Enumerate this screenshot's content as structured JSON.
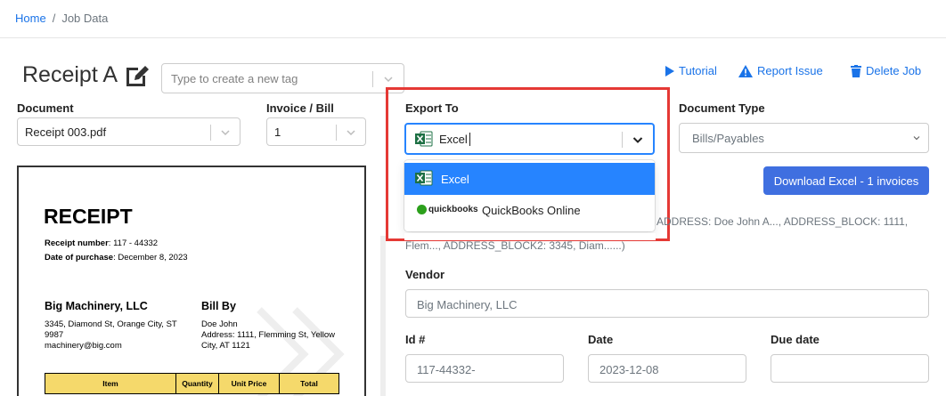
{
  "breadcrumb": {
    "home": "Home",
    "separator": "/",
    "current": "Job Data"
  },
  "header": {
    "title": "Receipt A",
    "tag_placeholder": "Type to create a new tag",
    "actions": {
      "tutorial": "Tutorial",
      "report": "Report Issue",
      "delete": "Delete Job"
    }
  },
  "document": {
    "label": "Document",
    "value": "Receipt 003.pdf"
  },
  "invoice": {
    "label": "Invoice / Bill",
    "value": "1"
  },
  "export": {
    "label": "Export To",
    "value": "Excel",
    "options": [
      {
        "label": "Excel",
        "selected": true
      },
      {
        "label": "QuickBooks Online",
        "logo_text": "quickbooks",
        "selected": false
      }
    ]
  },
  "document_type": {
    "label": "Document Type",
    "value": "Bills/Payables"
  },
  "download_button": "Download Excel - 1 invoices",
  "summary": {
    "line1": "ADDRESS: Doe John A..., ADDRESS_BLOCK: 1111,",
    "line2": "Flem..., ADDRESS_BLOCK2: 3345, Diam......)"
  },
  "fields": {
    "vendor": {
      "label": "Vendor",
      "value": "Big Machinery, LLC"
    },
    "id": {
      "label": "Id #",
      "value": "117-44332-"
    },
    "date": {
      "label": "Date",
      "value": "2023-12-08"
    },
    "due_date": {
      "label": "Due date",
      "value": ""
    }
  },
  "receipt": {
    "title": "RECEIPT",
    "number_label": "Receipt number",
    "number_value": ": 117 - 44332",
    "date_label": "Date of purchase",
    "date_value": ": December 8, 2023",
    "seller_name": "Big Machinery, LLC",
    "seller_address1": "3345, Diamond St, Orange City, ST",
    "seller_address2": "9987",
    "seller_email": "machinery@big.com",
    "bill_by_label": "Bill By",
    "bill_by_name": "Doe John",
    "bill_by_address1": "Address: 1111, Flemming St, Yellow",
    "bill_by_address2": "City, AT 1121",
    "table_headers": [
      "Item",
      "Quantity",
      "Unit Price",
      "Total"
    ]
  },
  "colors": {
    "link": "#1a73e8",
    "primary_button": "#3f6fe0",
    "selected_option": "#2684ff",
    "highlight_box": "#e53935",
    "table_header": "#f5d96b"
  }
}
